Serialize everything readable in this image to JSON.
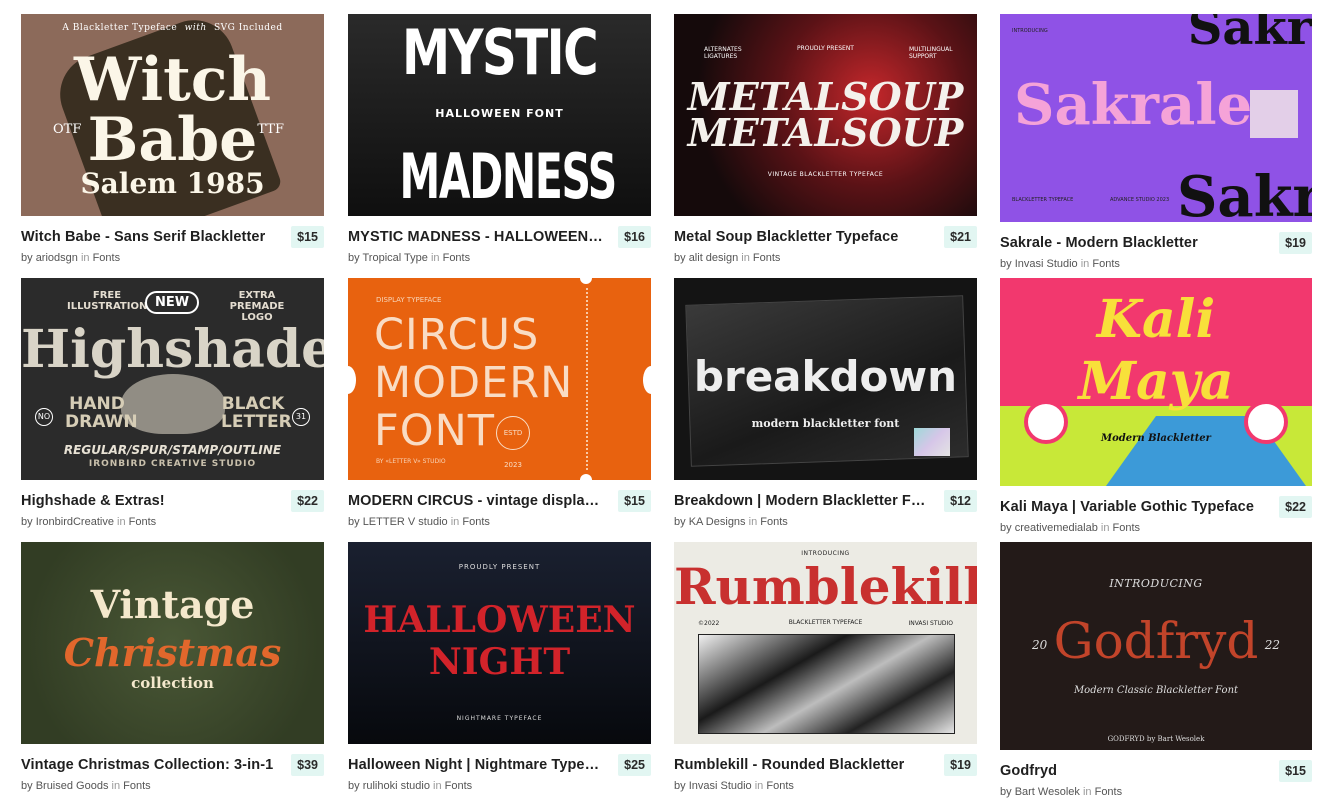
{
  "products": [
    {
      "title": "Witch Babe - Sans Serif Blackletter",
      "price": "$15",
      "author": "ariodsgn",
      "in_label": "in",
      "category": "Fonts",
      "thumb": {
        "bg": "#8c6a5a",
        "lines": [
          "A Blackletter Typeface",
          "with",
          "SVG Included",
          "Witch",
          "Babe",
          "Salem 1985",
          "OTF",
          "TTF"
        ]
      }
    },
    {
      "title": "MYSTIC MADNESS - HALLOWEEN FONT",
      "price": "$16",
      "author": "Tropical Type",
      "in_label": "in",
      "category": "Fonts",
      "thumb": {
        "bg": "#1c1c1c",
        "lines": [
          "MYSTIC",
          "HALLOWEEN FONT",
          "MADNESS"
        ]
      }
    },
    {
      "title": "Metal Soup Blackletter Typeface",
      "price": "$21",
      "author": "alit design",
      "in_label": "in",
      "category": "Fonts",
      "thumb": {
        "bg": "#2a1416",
        "lines": [
          "ALTERNATES LIGATURES",
          "PROUDLY PRESENT",
          "MULTILINGUAL SUPPORT",
          "METALSOUP",
          "METALSOUP",
          "VINTAGE BLACKLETTER TYPEFACE"
        ]
      }
    },
    {
      "title": "Sakrale - Modern Blackletter",
      "price": "$19",
      "author": "Invasi Studio",
      "in_label": "in",
      "category": "Fonts",
      "thumb": {
        "bg": "#8f52e6",
        "lines": [
          "INTRODUCING",
          "Sakrale",
          "Sakr",
          "BLACKLETTER TYPEFACE",
          "ADVANCE STUDIO 2023"
        ]
      }
    },
    {
      "title": "Highshade & Extras!",
      "price": "$22",
      "author": "IronbirdCreative",
      "in_label": "in",
      "category": "Fonts",
      "thumb": {
        "bg": "#2b2b2b",
        "lines": [
          "FREE ILLUSTRATION",
          "NEW",
          "EXTRA PREMADE LOGO",
          "Highshade",
          "HAND DRAWN",
          "BLACK LETTER",
          "NO",
          "31",
          "REGULAR/SPUR/STAMP/OUTLINE",
          "IRONBIRD CREATIVE STUDIO"
        ]
      }
    },
    {
      "title": "MODERN CIRCUS - vintage display font",
      "price": "$15",
      "author": "LETTER V studio",
      "in_label": "in",
      "category": "Fonts",
      "thumb": {
        "bg": "#e8620f",
        "lines": [
          "DISPLAY TYPEFACE",
          "CIRCUS",
          "MODERN",
          "FONT",
          "BY «LETTER V» STUDIO",
          "ESTD 2023"
        ]
      }
    },
    {
      "title": "Breakdown | Modern Blackletter Font",
      "price": "$12",
      "author": "KA Designs",
      "in_label": "in",
      "category": "Fonts",
      "thumb": {
        "bg": "#141414",
        "lines": [
          "breakdown",
          "modern blackletter font"
        ]
      }
    },
    {
      "title": "Kali Maya | Variable Gothic Typeface",
      "price": "$22",
      "author": "creativemedialab",
      "in_label": "in",
      "category": "Fonts",
      "thumb": {
        "bg": "#f2386e",
        "lines": [
          "Kali",
          "Maya",
          "Modern Blackletter"
        ]
      }
    },
    {
      "title": "Vintage Christmas Collection: 3-in-1",
      "price": "$39",
      "author": "Bruised Goods",
      "in_label": "in",
      "category": "Fonts",
      "thumb": {
        "bg": "#3d4a2c",
        "lines": [
          "Vintage",
          "Christmas",
          "collection"
        ]
      }
    },
    {
      "title": "Halloween Night | Nightmare Typeface",
      "price": "$25",
      "author": "rulihoki studio",
      "in_label": "in",
      "category": "Fonts",
      "thumb": {
        "bg": "#0d1018",
        "lines": [
          "PROUDLY PRESENT",
          "HALLOWEEN",
          "NIGHT",
          "NIGHTMARE TYPEFACE"
        ]
      }
    },
    {
      "title": "Rumblekill - Rounded Blackletter",
      "price": "$19",
      "author": "Invasi Studio",
      "in_label": "in",
      "category": "Fonts",
      "thumb": {
        "bg": "#ecebe4",
        "lines": [
          "INTRODUCING",
          "Rumblekill",
          "©2022",
          "BLACKLETTER TYPEFACE",
          "INVASI STUDIO"
        ]
      }
    },
    {
      "title": "Godfryd",
      "price": "$15",
      "author": "Bart Wesolek",
      "in_label": "in",
      "category": "Fonts",
      "thumb": {
        "bg": "#231a18",
        "lines": [
          "INTRODUCING",
          "20",
          "Godfryd",
          "22",
          "Modern Classic Blackletter Font",
          "GODFRYD by Bart Wesolek"
        ]
      }
    }
  ]
}
